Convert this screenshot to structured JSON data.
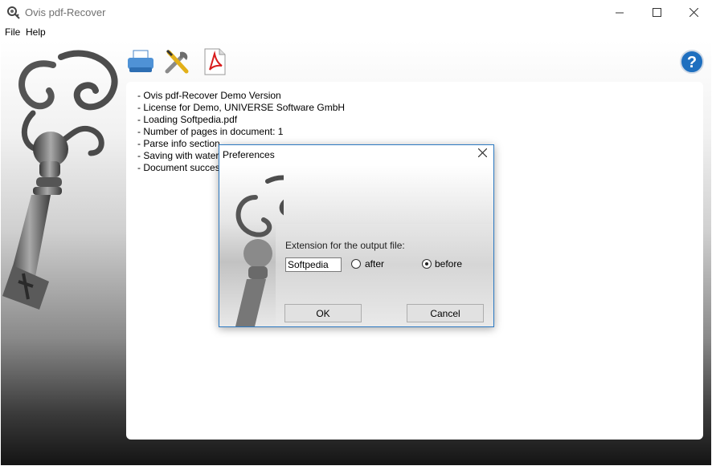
{
  "window": {
    "title": "Ovis pdf-Recover"
  },
  "menu": {
    "file": "File",
    "help": "Help"
  },
  "toolbar": {
    "icons": [
      "printer-icon",
      "tools-icon",
      "pdf-icon",
      "help-icon"
    ]
  },
  "log": {
    "lines": [
      "- Ovis pdf-Recover Demo Version",
      "- License for Demo, UNIVERSE Software GmbH",
      "- Loading Softpedia.pdf",
      "- Number of pages in document: 1",
      "- Parse info section",
      "- Saving with waterr",
      "- Document successf"
    ]
  },
  "dialog": {
    "title": "Preferences",
    "extension_label": "Extension for the output file:",
    "extension_value": "Softpedia",
    "radio_after": "after",
    "radio_before": "before",
    "selected": "before",
    "ok_label": "OK",
    "cancel_label": "Cancel"
  },
  "colors": {
    "dialog_border": "#2b79c2",
    "help_blue": "#1e6fbf",
    "pdf_red": "#d81c1c"
  }
}
